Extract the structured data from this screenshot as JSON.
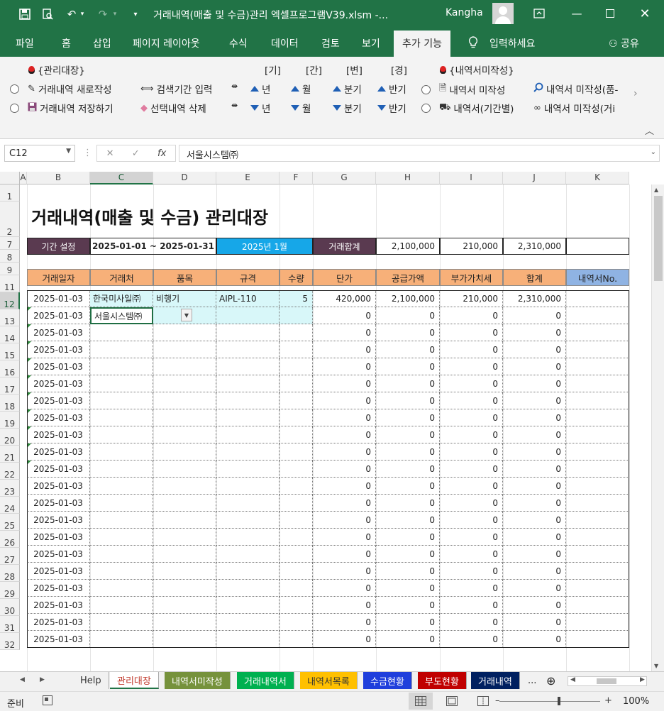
{
  "window": {
    "title": "거래내역(매출 및 수금)관리 엑셀프로그램V39.xlsm  -...",
    "user": "Kangha"
  },
  "menu": [
    "파일",
    "홈",
    "삽입",
    "페이지 레이아웃",
    "수식",
    "데이터",
    "검토",
    "보기",
    "추가 기능",
    "입력하세요"
  ],
  "menu_share": "공유",
  "ribbon": {
    "group1_title": "{관리대장}",
    "new_entry": "거래내역 새로작성",
    "save_entry": "거래내역 저장하기",
    "search_period": "검색기간 입력",
    "delete_selected": "선택내역 삭제",
    "period_heads": [
      "[기]",
      "[간]",
      "[변]",
      "[경]"
    ],
    "period_items": [
      "년",
      "월",
      "분기",
      "반기"
    ],
    "group2_title": "{내역서미작성}",
    "statement_unwritten": "내역서 미작성",
    "statement_by_period": "내역서(기간별)",
    "statement_unwritten_item": "내역서 미작성(품-",
    "statement_unwritten_cust": "내역서 미작성(거i"
  },
  "formula_bar": {
    "name_box": "C12",
    "formula": "서울시스템㈜"
  },
  "columns": [
    "A",
    "B",
    "C",
    "D",
    "E",
    "F",
    "G",
    "H",
    "I",
    "J",
    "K"
  ],
  "row_numbers": [
    "1",
    "2",
    "7",
    "8",
    "9",
    "11",
    "12",
    "13",
    "14",
    "15",
    "16",
    "17",
    "18",
    "19",
    "20",
    "21",
    "22",
    "23",
    "24",
    "25",
    "26",
    "27",
    "28",
    "29",
    "30",
    "31",
    "32"
  ],
  "sheet": {
    "title": "거래내역(매출 및 수금) 관리대장",
    "period_label": "기간 설정",
    "period_range": "2025-01-01  ~  2025-01-31",
    "period_month": "2025년 1월",
    "total_label": "거래합계",
    "total_supply": "2,100,000",
    "total_vat": "210,000",
    "total_sum": "2,310,000",
    "headers": [
      "거래일자",
      "거래처",
      "품목",
      "규격",
      "수량",
      "단가",
      "공급가액",
      "부가가치세",
      "합계",
      "내역서No."
    ],
    "rows": [
      [
        "2025-01-03",
        "한국미사일㈜",
        "비행기",
        "AIPL-110",
        "5",
        "420,000",
        "2,100,000",
        "210,000",
        "2,310,000",
        ""
      ],
      [
        "2025-01-03",
        "서울시스템㈜",
        "",
        "",
        "",
        "0",
        "0",
        "0",
        "0",
        ""
      ],
      [
        "2025-01-03",
        "",
        "",
        "",
        "",
        "0",
        "0",
        "0",
        "0",
        ""
      ],
      [
        "2025-01-03",
        "",
        "",
        "",
        "",
        "0",
        "0",
        "0",
        "0",
        ""
      ],
      [
        "2025-01-03",
        "",
        "",
        "",
        "",
        "0",
        "0",
        "0",
        "0",
        ""
      ],
      [
        "2025-01-03",
        "",
        "",
        "",
        "",
        "0",
        "0",
        "0",
        "0",
        ""
      ],
      [
        "2025-01-03",
        "",
        "",
        "",
        "",
        "0",
        "0",
        "0",
        "0",
        ""
      ],
      [
        "2025-01-03",
        "",
        "",
        "",
        "",
        "0",
        "0",
        "0",
        "0",
        ""
      ],
      [
        "2025-01-03",
        "",
        "",
        "",
        "",
        "0",
        "0",
        "0",
        "0",
        ""
      ],
      [
        "2025-01-03",
        "",
        "",
        "",
        "",
        "0",
        "0",
        "0",
        "0",
        ""
      ],
      [
        "2025-01-03",
        "",
        "",
        "",
        "",
        "0",
        "0",
        "0",
        "0",
        ""
      ],
      [
        "2025-01-03",
        "",
        "",
        "",
        "",
        "0",
        "0",
        "0",
        "0",
        ""
      ],
      [
        "2025-01-03",
        "",
        "",
        "",
        "",
        "0",
        "0",
        "0",
        "0",
        ""
      ],
      [
        "2025-01-03",
        "",
        "",
        "",
        "",
        "0",
        "0",
        "0",
        "0",
        ""
      ],
      [
        "2025-01-03",
        "",
        "",
        "",
        "",
        "0",
        "0",
        "0",
        "0",
        ""
      ],
      [
        "2025-01-03",
        "",
        "",
        "",
        "",
        "0",
        "0",
        "0",
        "0",
        ""
      ],
      [
        "2025-01-03",
        "",
        "",
        "",
        "",
        "0",
        "0",
        "0",
        "0",
        ""
      ],
      [
        "2025-01-03",
        "",
        "",
        "",
        "",
        "0",
        "0",
        "0",
        "0",
        ""
      ],
      [
        "2025-01-03",
        "",
        "",
        "",
        "",
        "0",
        "0",
        "0",
        "0",
        ""
      ],
      [
        "2025-01-03",
        "",
        "",
        "",
        "",
        "0",
        "0",
        "0",
        "0",
        ""
      ],
      [
        "2025-01-03",
        "",
        "",
        "",
        "",
        "0",
        "0",
        "0",
        "0",
        ""
      ]
    ]
  },
  "tabs": [
    {
      "label": "Help",
      "bg": "#f1f1f1",
      "fg": "#333333"
    },
    {
      "label": "관리대장",
      "bg": "#ffffff",
      "fg": "#c0392b"
    },
    {
      "label": "내역서미작성",
      "bg": "#76923c",
      "fg": "#ffffff"
    },
    {
      "label": "거래내역서",
      "bg": "#00b050",
      "fg": "#ffffff"
    },
    {
      "label": "내역서목록",
      "bg": "#ffc000",
      "fg": "#333333"
    },
    {
      "label": "수금현황",
      "bg": "#1f3fdc",
      "fg": "#ffffff"
    },
    {
      "label": "부도현황",
      "bg": "#c00000",
      "fg": "#ffffff"
    },
    {
      "label": "거래내역",
      "bg": "#002060",
      "fg": "#ffffff"
    }
  ],
  "tabs_more": "...",
  "status": {
    "ready": "준비",
    "zoom": "100%"
  },
  "colors": {
    "excel_green": "#217346",
    "header_orange": "#f7b079",
    "header_blue": "#8fb3e3",
    "period_dark": "#5a3a50",
    "period_blue": "#16a7e8",
    "active_row": "#d8f7f9"
  },
  "icons": [
    "save-icon",
    "print-preview-icon",
    "undo-icon",
    "redo-icon",
    "lightbulb-icon",
    "user-icon",
    "ribbon-display-icon",
    "minimize-icon",
    "maximize-icon",
    "close-icon",
    "pencil-icon",
    "floppy-icon",
    "range-icon",
    "eraser-icon",
    "arrows-icon",
    "document-icon",
    "handshake-icon",
    "magnifier-icon",
    "glasses-icon",
    "grid-view-icon",
    "page-layout-icon",
    "page-break-icon",
    "macro-record-icon"
  ]
}
